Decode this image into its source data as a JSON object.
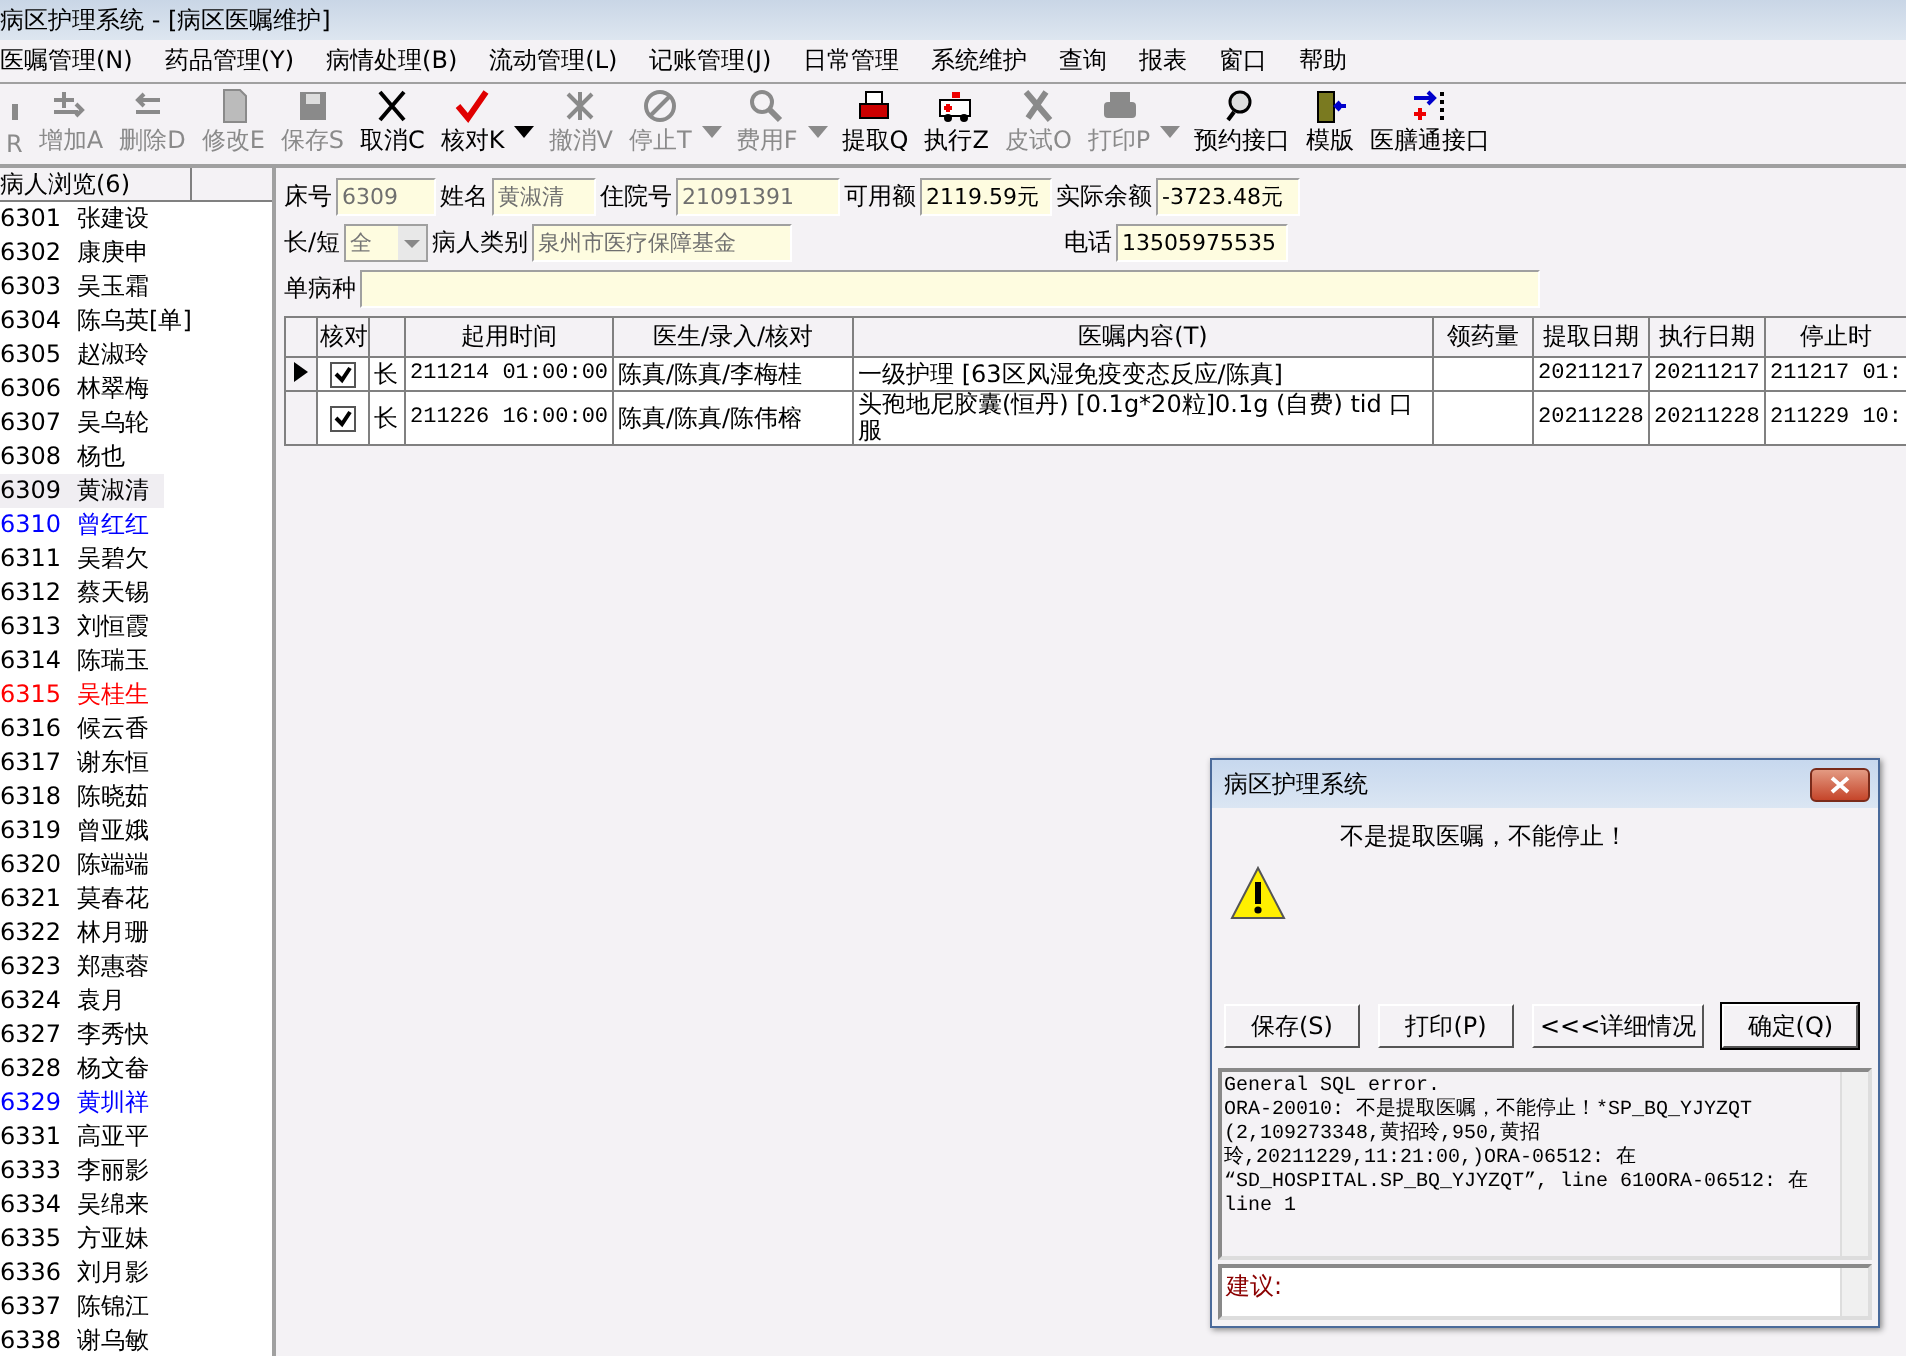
{
  "window": {
    "title": "病区护理系统 - [病区医嘱维护]"
  },
  "menu": [
    "医嘱管理(N)",
    "药品管理(Y)",
    "病情处理(B)",
    "流动管理(L)",
    "记账管理(J)",
    "日常管理",
    "系统维护",
    "查询",
    "报表",
    "窗口",
    "帮助"
  ],
  "toolbar": [
    {
      "kind": "partial",
      "label": "R",
      "disabled": true
    },
    {
      "kind": "add",
      "label": "增加A",
      "disabled": true
    },
    {
      "kind": "remove",
      "label": "删除D",
      "disabled": true
    },
    {
      "kind": "edit",
      "label": "修改E",
      "disabled": true
    },
    {
      "kind": "save",
      "label": "保存S",
      "disabled": true
    },
    {
      "kind": "cancel",
      "label": "取消C",
      "disabled": false
    },
    {
      "kind": "check",
      "label": "核对K",
      "disabled": false,
      "dropdown": true
    },
    {
      "kind": "undo",
      "label": "撤消V",
      "disabled": true
    },
    {
      "kind": "stop",
      "label": "停止T",
      "disabled": true,
      "dropdown": true
    },
    {
      "kind": "fee",
      "label": "费用F",
      "disabled": true,
      "dropdown": true
    },
    {
      "kind": "fetch",
      "label": "提取Q",
      "disabled": false
    },
    {
      "kind": "exec",
      "label": "执行Z",
      "disabled": false
    },
    {
      "kind": "skin",
      "label": "皮试O",
      "disabled": true
    },
    {
      "kind": "print",
      "label": "打印P",
      "disabled": true,
      "dropdown": true
    },
    {
      "kind": "appoint",
      "label": "预约接口",
      "disabled": false
    },
    {
      "kind": "template",
      "label": "模版",
      "disabled": false
    },
    {
      "kind": "diet",
      "label": "医膳通接口",
      "disabled": false
    }
  ],
  "patient_list": {
    "title": "病人浏览(6)",
    "items": [
      {
        "bed": "6301",
        "name": "张建设",
        "selected": false,
        "color": "#000000"
      },
      {
        "bed": "6302",
        "name": "康庚申",
        "selected": false,
        "color": "#000000"
      },
      {
        "bed": "6303",
        "name": "吴玉霜",
        "selected": false,
        "color": "#000000"
      },
      {
        "bed": "6304",
        "name": "陈乌英[单]",
        "selected": false,
        "color": "#000000"
      },
      {
        "bed": "6305",
        "name": "赵淑玲",
        "selected": false,
        "color": "#000000"
      },
      {
        "bed": "6306",
        "name": "林翠梅",
        "selected": false,
        "color": "#000000"
      },
      {
        "bed": "6307",
        "name": "吴乌轮",
        "selected": false,
        "color": "#000000"
      },
      {
        "bed": "6308",
        "name": "杨也",
        "selected": false,
        "color": "#000000"
      },
      {
        "bed": "6309",
        "name": "黄淑清",
        "selected": true,
        "color": "#000000"
      },
      {
        "bed": "6310",
        "name": "曾红红",
        "selected": false,
        "color": "#0000ff"
      },
      {
        "bed": "6311",
        "name": "吴碧欠",
        "selected": false,
        "color": "#000000"
      },
      {
        "bed": "6312",
        "name": "蔡天锡",
        "selected": false,
        "color": "#000000"
      },
      {
        "bed": "6313",
        "name": "刘恒霞",
        "selected": false,
        "color": "#000000"
      },
      {
        "bed": "6314",
        "name": "陈瑞玉",
        "selected": false,
        "color": "#000000"
      },
      {
        "bed": "6315",
        "name": "吴桂生",
        "selected": false,
        "color": "#ff0000"
      },
      {
        "bed": "6316",
        "name": "候云香",
        "selected": false,
        "color": "#000000"
      },
      {
        "bed": "6317",
        "name": "谢东恒",
        "selected": false,
        "color": "#000000"
      },
      {
        "bed": "6318",
        "name": "陈晓茹",
        "selected": false,
        "color": "#000000"
      },
      {
        "bed": "6319",
        "name": "曾亚娥",
        "selected": false,
        "color": "#000000"
      },
      {
        "bed": "6320",
        "name": "陈端端",
        "selected": false,
        "color": "#000000"
      },
      {
        "bed": "6321",
        "name": "莫春花",
        "selected": false,
        "color": "#000000"
      },
      {
        "bed": "6322",
        "name": "林月珊",
        "selected": false,
        "color": "#000000"
      },
      {
        "bed": "6323",
        "name": "郑惠蓉",
        "selected": false,
        "color": "#000000"
      },
      {
        "bed": "6324",
        "name": "袁月",
        "selected": false,
        "color": "#000000"
      },
      {
        "bed": "6327",
        "name": "李秀快",
        "selected": false,
        "color": "#000000"
      },
      {
        "bed": "6328",
        "name": "杨文畚",
        "selected": false,
        "color": "#000000"
      },
      {
        "bed": "6329",
        "name": "黄圳祥",
        "selected": false,
        "color": "#0000ff"
      },
      {
        "bed": "6331",
        "name": "高亚平",
        "selected": false,
        "color": "#000000"
      },
      {
        "bed": "6333",
        "name": "李丽影",
        "selected": false,
        "color": "#000000"
      },
      {
        "bed": "6334",
        "name": "吴绵来",
        "selected": false,
        "color": "#000000"
      },
      {
        "bed": "6335",
        "name": "方亚妹",
        "selected": false,
        "color": "#000000"
      },
      {
        "bed": "6336",
        "name": "刘月影",
        "selected": false,
        "color": "#000000"
      },
      {
        "bed": "6337",
        "name": "陈锦江",
        "selected": false,
        "color": "#000000"
      },
      {
        "bed": "6338",
        "name": "谢乌敏",
        "selected": false,
        "color": "#000000"
      }
    ]
  },
  "form": {
    "bed_label": "床号",
    "bed": "6309",
    "name_label": "姓名",
    "name": "黄淑清",
    "inpatient_label": "住院号",
    "inpatient_no": "21091391",
    "available_label": "可用额",
    "available": "2119.59元",
    "balance_label": "实际余额",
    "balance": "-3723.48元",
    "term_label": "长/短",
    "term": "全",
    "category_label": "病人类别",
    "category": "泉州市医疗保障基金",
    "phone_label": "电话",
    "phone": "13505975535",
    "disease_label": "单病种"
  },
  "table": {
    "columns": [
      "",
      "核对",
      "",
      "起用时间",
      "医生/录入/核对",
      "医嘱内容(T)",
      "领药量",
      "提取日期",
      "执行日期",
      "停止时"
    ],
    "rows": [
      {
        "current": true,
        "checked": true,
        "cells": [
          "",
          "",
          "长",
          "211214 01:00:00",
          "陈真/陈真/李梅桂",
          "一级护理    [63区风湿免疫变态反应/陈真]",
          "",
          "20211217",
          "20211217",
          "211217 01:"
        ]
      },
      {
        "current": false,
        "checked": true,
        "cells": [
          "",
          "",
          "长",
          "211226 16:00:00",
          "陈真/陈真/陈伟榕",
          "头孢地尼胶囊(恒丹) [0.1g*20粒]0.1g (自费) tid 口服",
          "",
          "20211228",
          "20211228",
          "211229 10:"
        ]
      }
    ]
  },
  "dialog": {
    "title": "病区护理系统",
    "message": "不是提取医嘱，不能停止！",
    "buttons": [
      {
        "label": "保存(S)",
        "default": false
      },
      {
        "label": "打印(P)",
        "default": false
      },
      {
        "label": "<<<详细情况",
        "default": false
      },
      {
        "label": "确定(Q)",
        "default": true
      }
    ],
    "details": [
      "General SQL error.",
      "ORA-20010: 不是提取医嘱，不能停止！*SP_BQ_YJYZQT",
      "(2,109273348,黄招玲,950,黄招",
      "玲,20211229,11:21:00,)ORA-06512: 在",
      "“SD_HOSPITAL.SP_BQ_YJYZQT”, line 610ORA-06512: 在",
      "line 1"
    ],
    "suggestion_label": "建议:"
  }
}
